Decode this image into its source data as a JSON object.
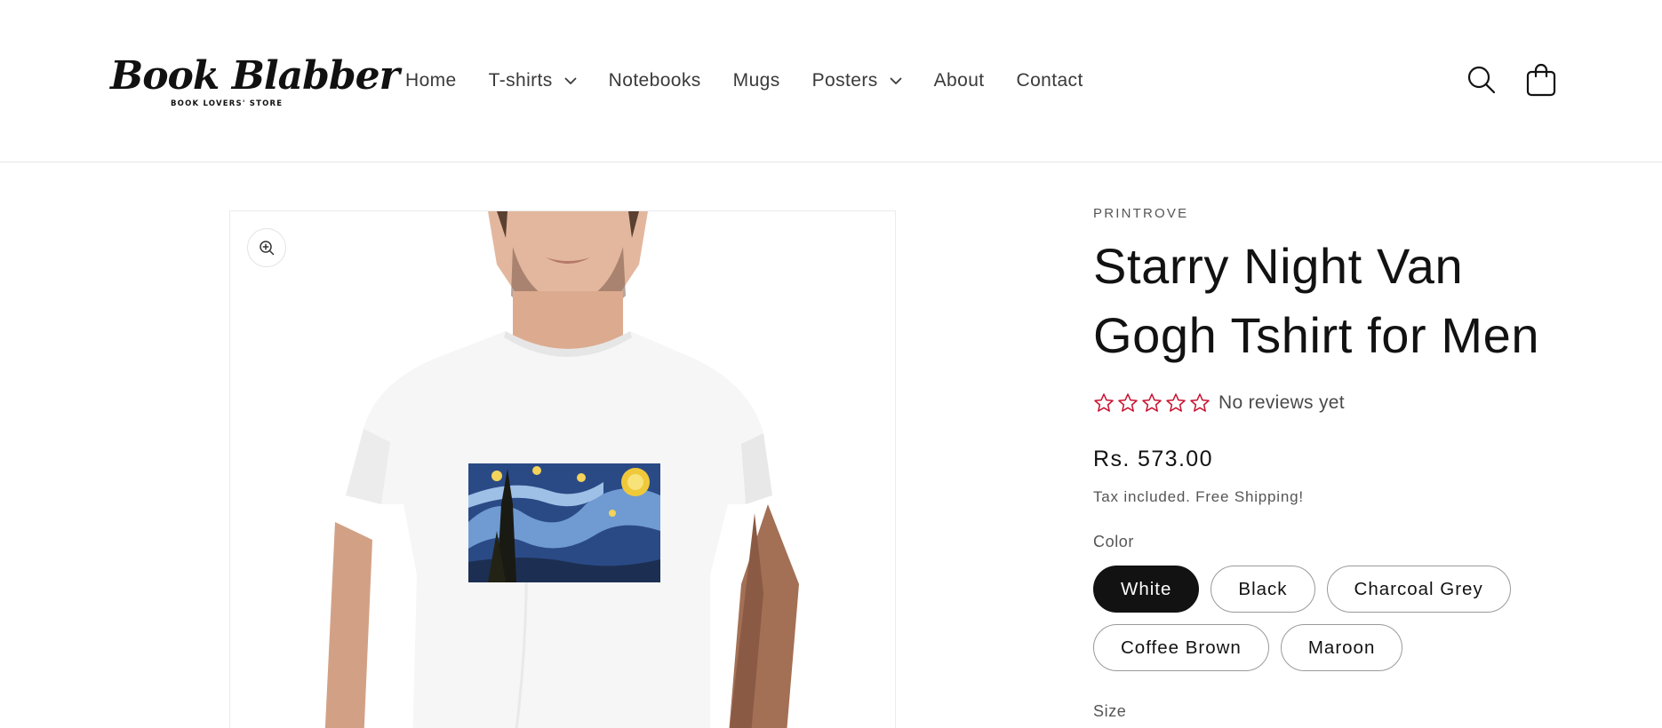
{
  "header": {
    "logo_text": "Book Blabber",
    "logo_tagline": "BOOK LOVERS' STORE",
    "nav": [
      {
        "label": "Home",
        "has_dropdown": false
      },
      {
        "label": "T-shirts",
        "has_dropdown": true
      },
      {
        "label": "Notebooks",
        "has_dropdown": false
      },
      {
        "label": "Mugs",
        "has_dropdown": false
      },
      {
        "label": "Posters",
        "has_dropdown": true
      },
      {
        "label": "About",
        "has_dropdown": false
      },
      {
        "label": "Contact",
        "has_dropdown": false
      }
    ],
    "icons": [
      "search-icon",
      "cart-icon",
      "chevron-down-icon"
    ]
  },
  "gallery": {
    "zoom_icon": "zoom-in-icon",
    "image_subject": "starry-night-tshirt"
  },
  "product": {
    "vendor": "PRINTROVE",
    "title": "Starry Night Van Gogh Tshirt for Men",
    "rating": {
      "stars_filled": 0,
      "stars_total": 5,
      "reviews_text": "No reviews yet"
    },
    "price": "Rs. 573.00",
    "tax_note": "Tax included. Free Shipping!",
    "color_label": "Color",
    "colors": [
      {
        "label": "White",
        "selected": true
      },
      {
        "label": "Black",
        "selected": false
      },
      {
        "label": "Charcoal Grey",
        "selected": false
      },
      {
        "label": "Coffee Brown",
        "selected": false
      },
      {
        "label": "Maroon",
        "selected": false
      }
    ],
    "size_label": "Size"
  },
  "colors": {
    "star_outline": "#c8102e",
    "selected_pill_bg": "#121212",
    "pill_border": "#9a9a9a",
    "text_primary": "#121212",
    "text_muted": "#555555"
  }
}
